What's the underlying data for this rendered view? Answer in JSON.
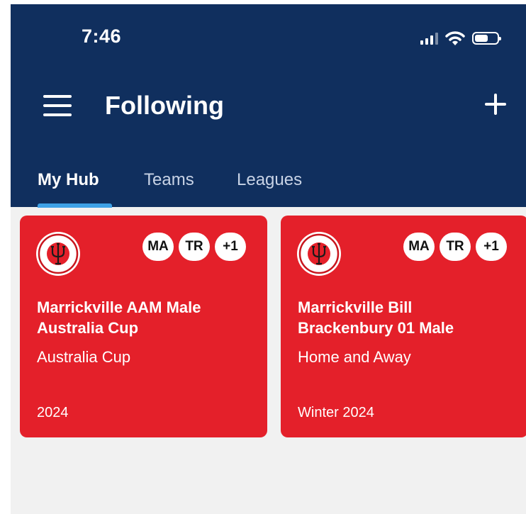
{
  "status_bar": {
    "time": "7:46",
    "icons": [
      "cellular-signal-icon",
      "wifi-icon",
      "battery-icon"
    ]
  },
  "header": {
    "title": "Following",
    "menu_icon": "hamburger-menu-icon",
    "add_icon": "plus-icon"
  },
  "tabs": [
    {
      "label": "My Hub",
      "active": true
    },
    {
      "label": "Teams",
      "active": false
    },
    {
      "label": "Leagues",
      "active": false
    }
  ],
  "cards": [
    {
      "title": "Marrickville AAM Male Australia Cup",
      "competition": "Australia Cup",
      "season": "2024",
      "chips": [
        "MA",
        "TR",
        "+1"
      ],
      "logo": "marrickville-fc-crest"
    },
    {
      "title": "Marrickville Bill Brackenbury 01 Male",
      "competition": "Home and Away",
      "season": "Winter 2024",
      "chips": [
        "MA",
        "TR",
        "+1"
      ],
      "logo": "marrickville-fc-crest"
    }
  ],
  "colors": {
    "header_bg": "#102f5e",
    "card_bg": "#e4202a",
    "tab_indicator": "#3ea1e6",
    "page_bg": "#f1f1f1"
  }
}
